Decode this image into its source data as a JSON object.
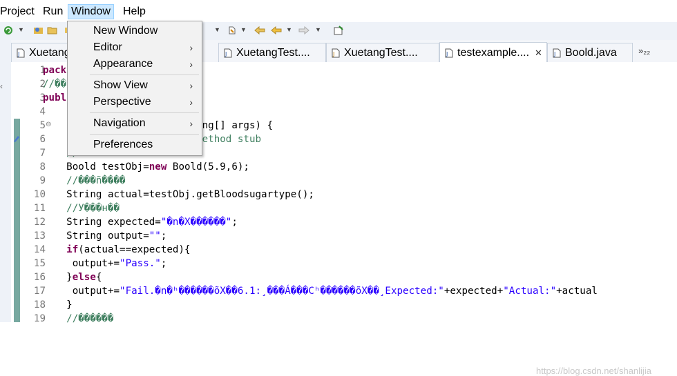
{
  "menubar": {
    "items": [
      "Project",
      "Run",
      "Window",
      "Help"
    ],
    "active": "Window"
  },
  "window_menu": {
    "items": [
      {
        "label": "New Window",
        "submenu": false
      },
      {
        "label": "Editor",
        "submenu": true
      },
      {
        "label": "Appearance",
        "submenu": true
      },
      {
        "label": "Show View",
        "submenu": true
      },
      {
        "label": "Perspective",
        "submenu": true
      },
      {
        "label": "Navigation",
        "submenu": true
      },
      {
        "label": "Preferences",
        "submenu": false
      }
    ],
    "submenu_arrow": "›"
  },
  "tabs": [
    {
      "label": "Xuetang",
      "icon": "java-file-icon"
    },
    {
      "label": "XuetangTest....",
      "icon": "java-file-icon"
    },
    {
      "label": "XuetangTest....",
      "icon": "java-file-icon"
    },
    {
      "label": "testexample....",
      "icon": "java-file-icon",
      "active": true,
      "close": "✕"
    },
    {
      "label": "Boold.java",
      "icon": "java-file-icon"
    }
  ],
  "tab_overflow": "»₂₂",
  "editor": {
    "line_numbers": [
      "1",
      "2",
      "3",
      "4",
      "5",
      "6",
      "7",
      "8",
      "9",
      "10",
      "11",
      "12",
      "13",
      "14",
      "15",
      "16",
      "17",
      "18",
      "19"
    ],
    "fold_marker": "⊖",
    "lines": [
      [
        {
          "t": "pack",
          "c": "kw"
        }
      ],
      [
        {
          "t": "//��",
          "c": "cm"
        }
      ],
      [
        {
          "t": "publ",
          "c": "kw"
        },
        {
          "t": "                     {",
          "c": ""
        }
      ],
      [
        {
          "t": "",
          "c": ""
        }
      ],
      [
        {
          "t": "                    in(String[] args) {",
          "c": ""
        }
      ],
      [
        {
          "t": "                    rated method stub",
          "c": "cm"
        }
      ],
      [
        {
          "t": "    //",
          "c": "cm"
        }
      ],
      [
        {
          "t": "    Boold testObj=",
          "c": ""
        },
        {
          "t": "new",
          "c": "kw"
        },
        {
          "t": " Boold(5.9,6);",
          "c": ""
        }
      ],
      [
        {
          "t": "    //���ñ����",
          "c": "cm"
        }
      ],
      [
        {
          "t": "    String actual=testObj.getBloodsugartype();",
          "c": ""
        }
      ],
      [
        {
          "t": "    //У���н��",
          "c": "cm"
        }
      ],
      [
        {
          "t": "    String expected=",
          "c": ""
        },
        {
          "t": "\"�n�Χ������\"",
          "c": "str"
        },
        {
          "t": ";",
          "c": ""
        }
      ],
      [
        {
          "t": "    String output=",
          "c": ""
        },
        {
          "t": "\"\"",
          "c": "str"
        },
        {
          "t": ";",
          "c": ""
        }
      ],
      [
        {
          "t": "    ",
          "c": ""
        },
        {
          "t": "if",
          "c": "kw"
        },
        {
          "t": "(actual==expected){",
          "c": ""
        }
      ],
      [
        {
          "t": "     output+=",
          "c": ""
        },
        {
          "t": "\"Pass.\"",
          "c": "str"
        },
        {
          "t": ";",
          "c": ""
        }
      ],
      [
        {
          "t": "    }",
          "c": ""
        },
        {
          "t": "else",
          "c": "kw"
        },
        {
          "t": "{",
          "c": ""
        }
      ],
      [
        {
          "t": "     output+=",
          "c": ""
        },
        {
          "t": "\"Fail.�n�ʰ������õΧ��6.1:¸���Á���Cʰ������õΧ��¸Expected:\"",
          "c": "str"
        },
        {
          "t": "+expected+",
          "c": ""
        },
        {
          "t": "\"Actual:\"",
          "c": "str"
        },
        {
          "t": "+actual",
          "c": ""
        }
      ],
      [
        {
          "t": "    }",
          "c": ""
        }
      ],
      [
        {
          "t": "    //������",
          "c": "cm"
        }
      ]
    ]
  },
  "watermark": "https://blog.csdn.net/shanlijia",
  "colors": {
    "menu_highlight": "#cce8ff",
    "keyword": "#7f0055",
    "comment": "#3f7f5f",
    "string": "#2a00ff",
    "change_bar": "#77a8a0"
  }
}
